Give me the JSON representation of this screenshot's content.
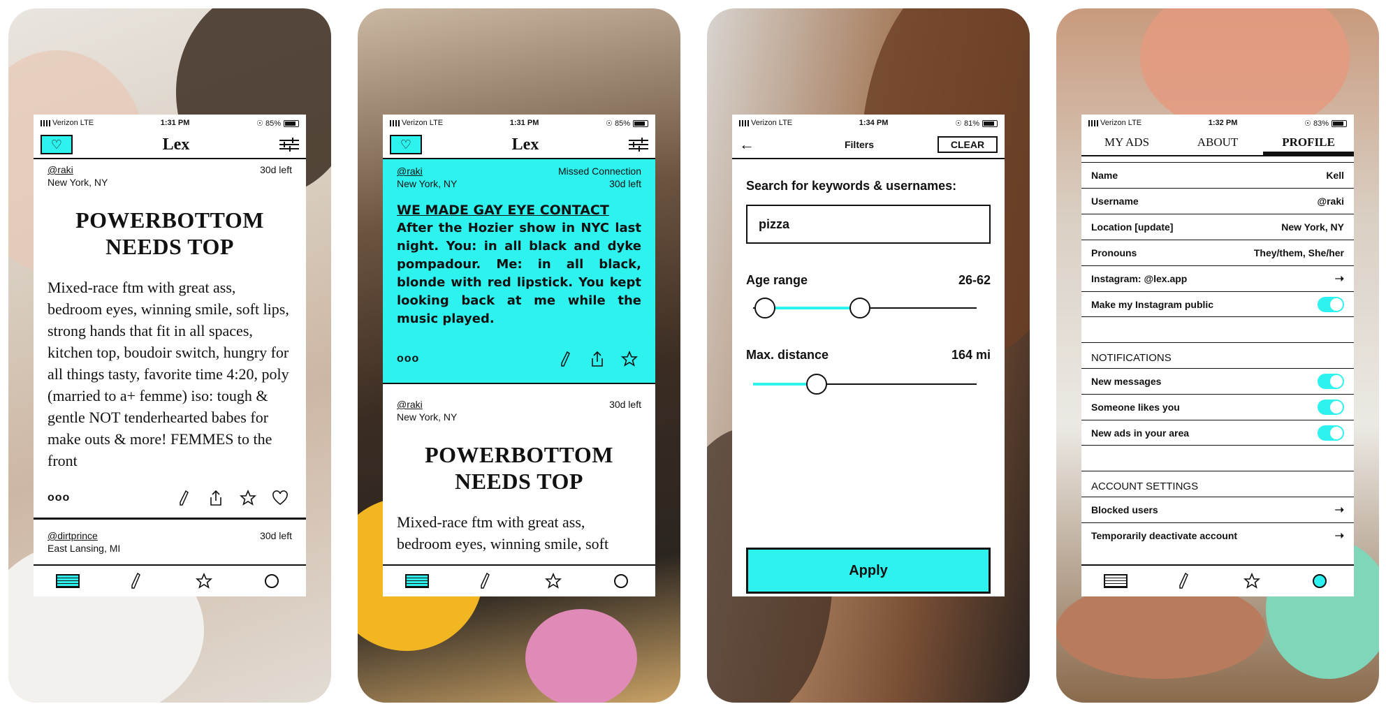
{
  "status_bars": [
    {
      "carrier": "Verizon",
      "network": "LTE",
      "time": "1:31 PM",
      "battery": "85%"
    },
    {
      "carrier": "Verizon",
      "network": "LTE",
      "time": "1:31 PM",
      "battery": "85%"
    },
    {
      "carrier": "Verizon",
      "network": "LTE",
      "time": "1:34 PM",
      "battery": "81%"
    },
    {
      "carrier": "Verizon",
      "network": "LTE",
      "time": "1:32 PM",
      "battery": "83%"
    }
  ],
  "brand": {
    "logo": "Lex",
    "accent": "#2ef2ee"
  },
  "screen1": {
    "post": {
      "user": "@raki",
      "location": "New York, NY",
      "time_left": "30d left",
      "title_line1": "POWERBOTTOM",
      "title_line2": "NEEDS TOP",
      "body": "Mixed-race ftm with great ass, bedroom eyes, winning smile, soft lips, strong hands that fit in all spaces, kitchen top, boudoir switch, hungry for all things tasty, favorite time 4:20, poly (married to a+ femme) iso: tough & gentle NOT tenderhearted babes for make outs & more! FEMMES to the front",
      "more": "ooo"
    },
    "next_post": {
      "user": "@dirtprince",
      "location": "East Lansing, MI",
      "time_left": "30d left"
    }
  },
  "screen2": {
    "post": {
      "user": "@raki",
      "location": "New York, NY",
      "tag": "Missed Connection",
      "time_left": "30d left",
      "title": "WE MADE GAY EYE CONTACT",
      "body": "After the Hozier show in NYC last night. You: in all black and dyke pompadour. Me: in all black, blonde with red lipstick. You kept looking back at me while the music played.",
      "more": "ooo"
    },
    "next_post": {
      "user": "@raki",
      "location": "New York, NY",
      "time_left": "30d left",
      "title_line1": "POWERBOTTOM",
      "title_line2": "NEEDS TOP",
      "body": "Mixed-race ftm with great ass, bedroom eyes, winning smile, soft"
    }
  },
  "screen3": {
    "title": "Filters",
    "clear_label": "CLEAR",
    "search_label": "Search for keywords & usernames:",
    "search_value": "pizza",
    "age_label": "Age range",
    "age_value": "26-62",
    "age_low": 26,
    "age_high": 62,
    "distance_label": "Max. distance",
    "distance_value": "164 mi",
    "distance_fraction": 0.2,
    "apply_label": "Apply"
  },
  "screen4": {
    "tabs": [
      "MY ADS",
      "ABOUT",
      "PROFILE"
    ],
    "profile_rows": [
      {
        "label": "Name",
        "value": "Kell"
      },
      {
        "label": "Username",
        "value": "@raki"
      },
      {
        "label": "Location [update]",
        "value": "New York, NY"
      },
      {
        "label": "Pronouns",
        "value": "They/them, She/her"
      }
    ],
    "instagram_label": "Instagram: @lex.app",
    "instagram_public_label": "Make my Instagram public",
    "notifications_heading": "NOTIFICATIONS",
    "notifications": [
      "New messages",
      "Someone likes you",
      "New ads in your area"
    ],
    "account_heading": "ACCOUNT SETTINGS",
    "account_rows": [
      "Blocked users",
      "Temporarily deactivate account"
    ]
  }
}
